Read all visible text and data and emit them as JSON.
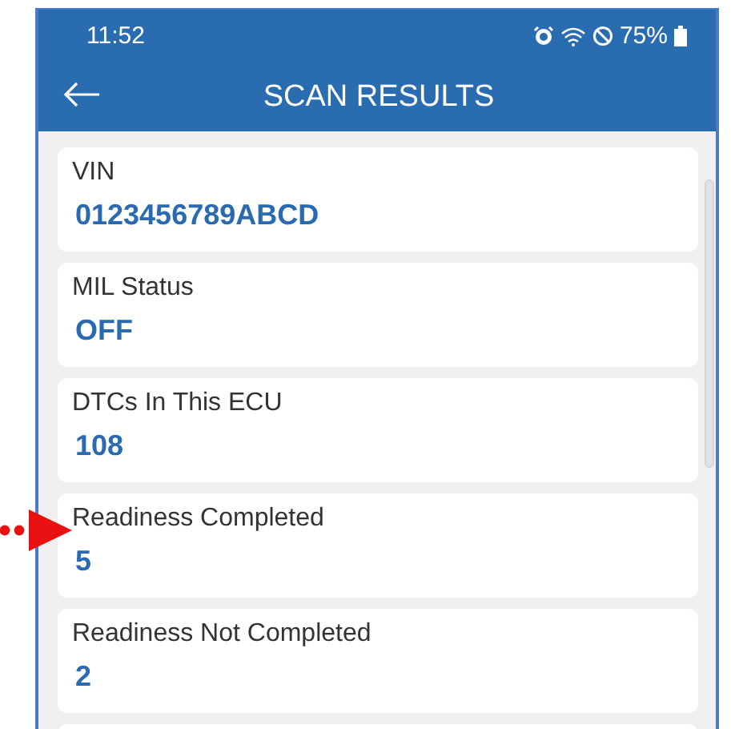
{
  "status_bar": {
    "time": "11:52",
    "battery": "75%"
  },
  "app_bar": {
    "title": "SCAN RESULTS"
  },
  "results": [
    {
      "label": "VIN",
      "value": "0123456789ABCD"
    },
    {
      "label": "MIL Status",
      "value": "OFF"
    },
    {
      "label": "DTCs In This ECU",
      "value": "108"
    },
    {
      "label": "Readiness Completed",
      "value": "5"
    },
    {
      "label": "Readiness Not Completed",
      "value": "2"
    }
  ]
}
